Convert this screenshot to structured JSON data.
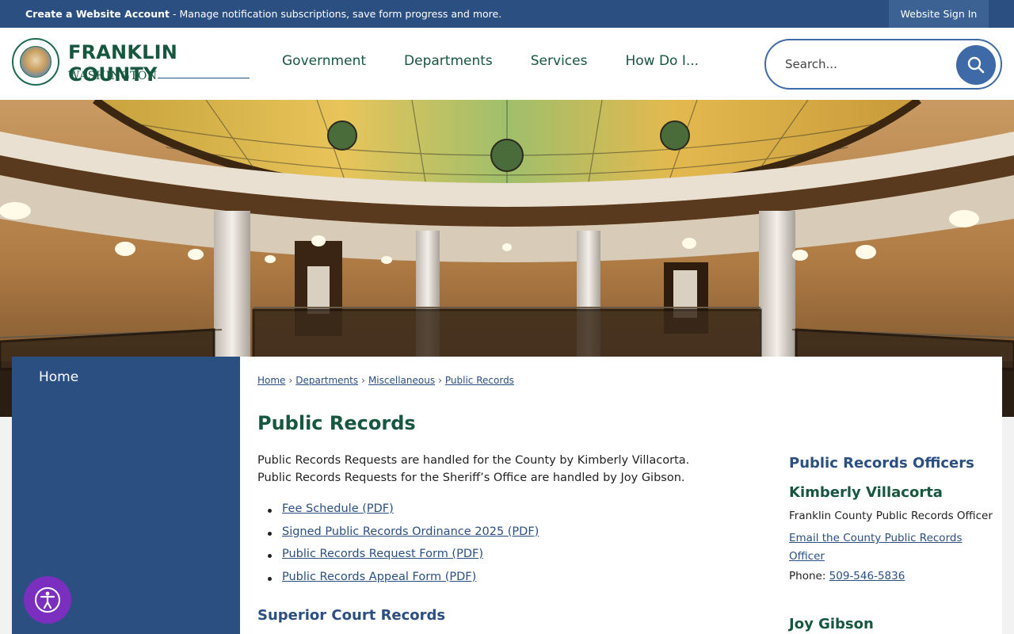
{
  "topbar": {
    "account_link": "Create a Website Account",
    "account_desc": " - Manage notification subscriptions, save form progress and more.",
    "signin": "Website Sign In"
  },
  "logo": {
    "title": "FRANKLIN COUNTY",
    "subtitle": "WASHINGTON"
  },
  "nav": {
    "items": [
      {
        "label": "Government"
      },
      {
        "label": "Departments"
      },
      {
        "label": "Services"
      },
      {
        "label": "How Do I..."
      }
    ]
  },
  "search": {
    "placeholder": "Search...",
    "icon": "search-icon"
  },
  "sidebar": {
    "home": "Home"
  },
  "breadcrumb": {
    "items": [
      "Home",
      "Departments",
      "Miscellaneous",
      "Public Records"
    ],
    "separator": "›"
  },
  "main": {
    "title": "Public Records",
    "intro_line1": "Public Records Requests are handled for the County by Kimberly Villacorta.",
    "intro_line2": "Public Records Requests for the Sheriff’s Office are handled by Joy Gibson.",
    "links": [
      "Fee Schedule (PDF)",
      "Signed Public Records Ordinance 2025 (PDF)",
      "Public Records Request Form (PDF)",
      "Public Records Appeal Form (PDF)"
    ],
    "subheading": "Superior Court Records"
  },
  "aside": {
    "heading": "Public Records Officers",
    "officer1_name": "Kimberly Villacorta",
    "officer1_role": "Franklin County Public Records Officer",
    "officer1_email": "Email the County Public Records Officer",
    "officer1_phone_label": "Phone: ",
    "officer1_phone": "509-546-5836",
    "officer2_name": "Joy Gibson"
  },
  "colors": {
    "topbar": "#2b4f81",
    "brand_green": "#17563f",
    "link_blue": "#2b4f81",
    "accessibility_purple": "#7b2fbf"
  },
  "icons": {
    "accessibility": "accessibility-icon"
  }
}
